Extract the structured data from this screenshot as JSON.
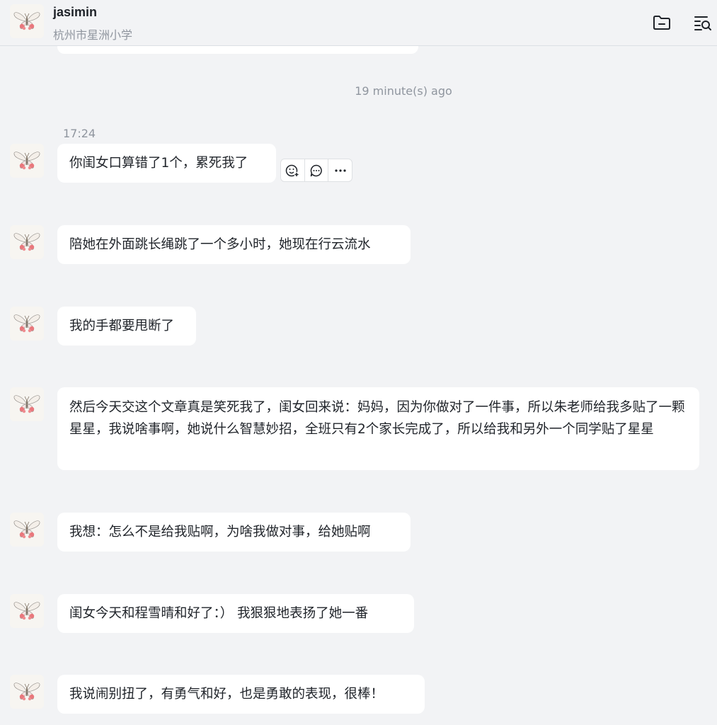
{
  "chat": {
    "name": "jasimin",
    "subtitle": "杭州市星洲小学"
  },
  "header_icons": [
    "folder-icon",
    "search-in-chat-icon"
  ],
  "separator_time": "19 minute(s) ago",
  "first_message_time": "17:24",
  "hover_toolbar": [
    "add-reaction-icon",
    "reply-icon",
    "more-icon"
  ],
  "messages": [
    {
      "text": "你闺女口算错了1个，累死我了"
    },
    {
      "text": "陪她在外面跳长绳跳了一个多小时，她现在行云流水"
    },
    {
      "text": "我的手都要甩断了"
    },
    {
      "text": "然后今天交这个文章真是笑死我了，闺女回来说：妈妈，因为你做对了一件事，所以朱老师给我多贴了一颗星星，我说啥事啊，她说什么智慧妙招，全班只有2个家长完成了，所以给我和另外一个同学贴了星星"
    },
    {
      "text": "我想：怎么不是给我贴啊，为啥我做对事，给她贴啊"
    },
    {
      "text": "闺女今天和程雪晴和好了：）  我狠狠地表扬了她一番"
    },
    {
      "text": "我说闹别扭了，有勇气和好，也是勇敢的表现，很棒！"
    }
  ]
}
